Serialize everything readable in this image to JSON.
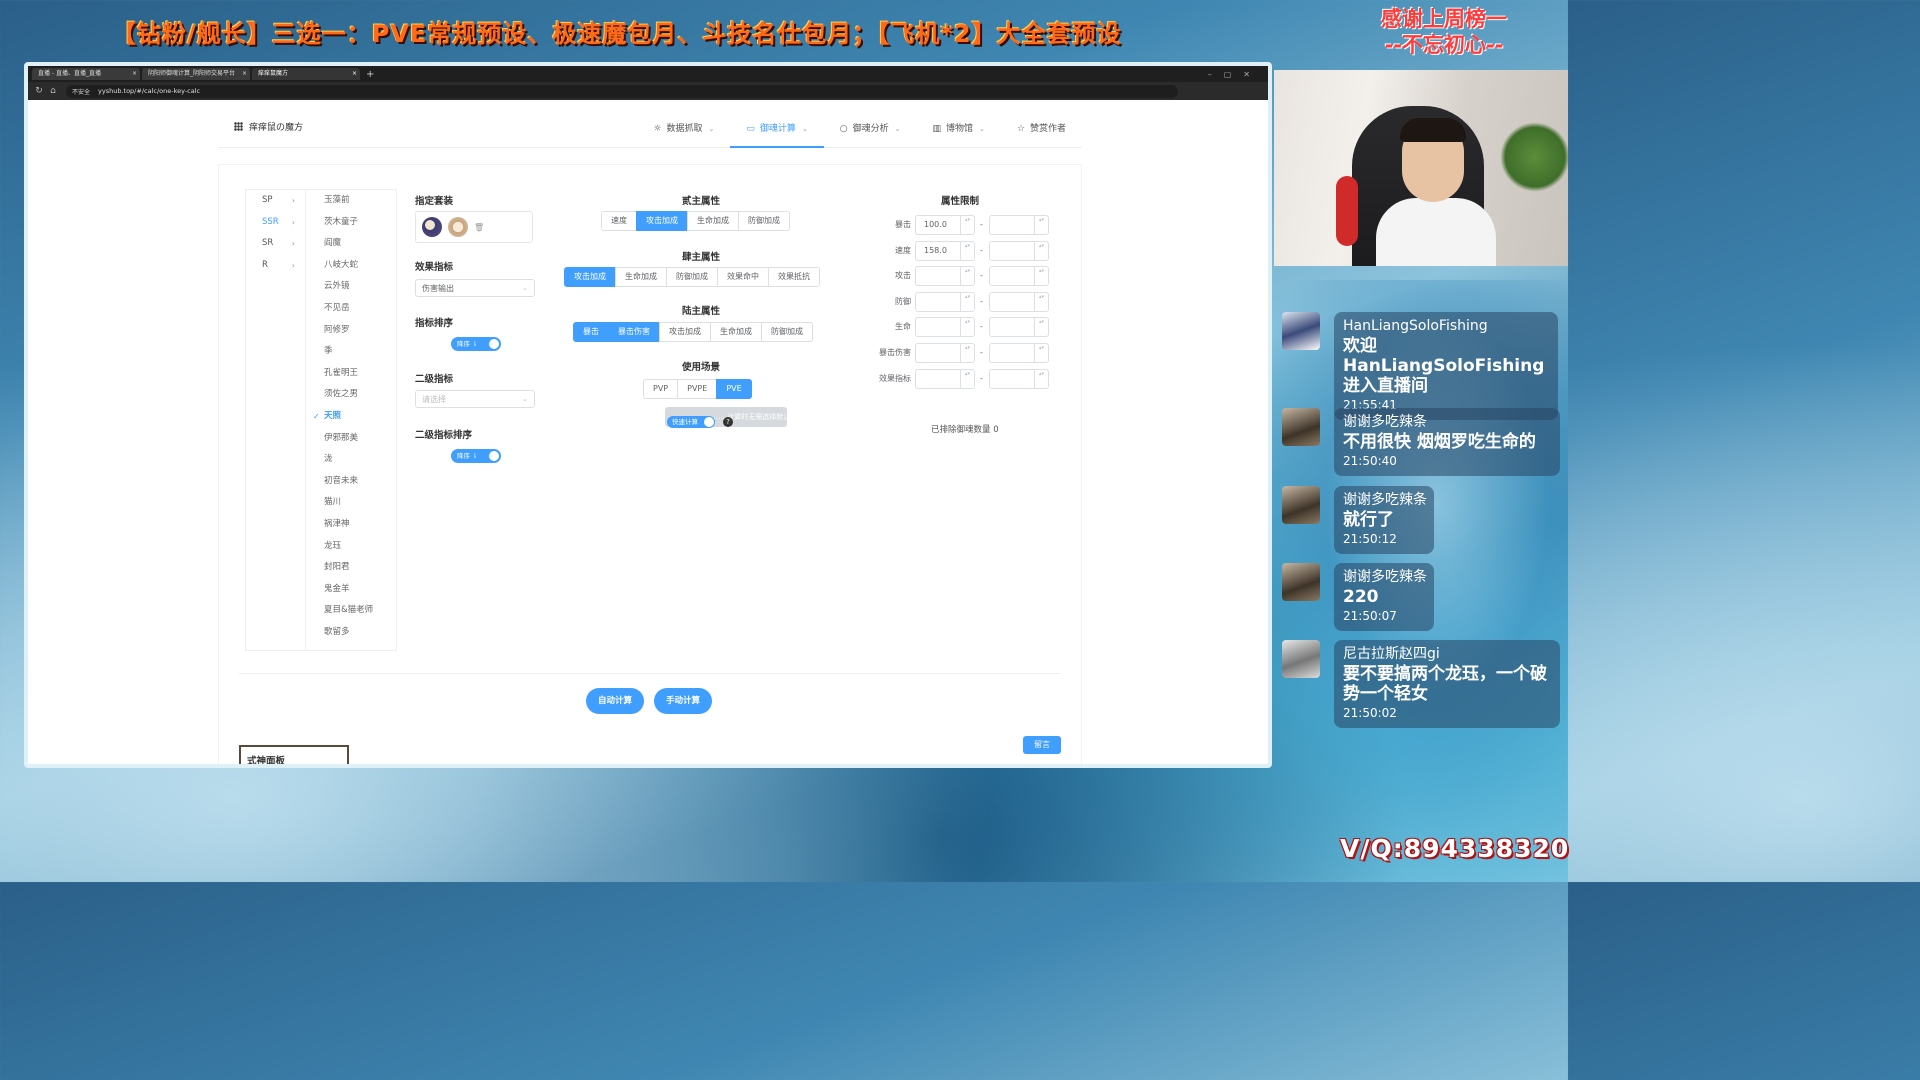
{
  "stream": {
    "title": "【钻粉/舰长】三选一：PVE常规预设、极速魔包月、斗技名仕包月；【飞机*2】大全套预设",
    "thanks_line1": "感谢上周榜一",
    "thanks_line2": "--不忘初心--",
    "contact": "V/Q:894338320"
  },
  "browser": {
    "tabs": [
      {
        "label": "直播 - 直播、直播_直播",
        "close": "×"
      },
      {
        "label": "阴阳师御魂计算_阴阳师交易平台",
        "close": "×"
      },
      {
        "label": "痒痒鼠魔方",
        "close": "×"
      }
    ],
    "new_tab": "+",
    "insecure_label": "不安全",
    "url": "yyshub.top/#/calc/one-key-calc"
  },
  "site": {
    "brand": "痒痒鼠の魔方",
    "menu": [
      {
        "icon": "☼",
        "label": "数据抓取",
        "chev": "⌄"
      },
      {
        "icon": "▭",
        "label": "御魂计算",
        "chev": "⌄",
        "active": true
      },
      {
        "icon": "○",
        "label": "御魂分析",
        "chev": "⌄"
      },
      {
        "icon": "▥",
        "label": "博物馆",
        "chev": "⌄"
      },
      {
        "icon": "☆",
        "label": "赞赏作者",
        "chev": ""
      }
    ]
  },
  "rarity": [
    {
      "label": "SP",
      "arrow": "›"
    },
    {
      "label": "SSR",
      "arrow": "›",
      "active": true
    },
    {
      "label": "SR",
      "arrow": "›"
    },
    {
      "label": "R",
      "arrow": "›"
    }
  ],
  "shikigami": [
    "玉藻前",
    "茨木童子",
    "阎魔",
    "八岐大蛇",
    "云外镜",
    "不见岳",
    "阿修罗",
    "季",
    "孔雀明王",
    "须佐之男",
    "天照",
    "伊邪那美",
    "泷",
    "初音未来",
    "猫川",
    "祸津神",
    "龙珏",
    "封阳君",
    "鬼金羊",
    "夏目&猫老师",
    "歌留多"
  ],
  "shikigami_active_index": 10,
  "form": {
    "suit_label": "指定套装",
    "effect_label": "效果指标",
    "effect_value": "伤害输出",
    "sort_label": "指标排序",
    "sort_switch": "降序 ⇂",
    "second_label": "二级指标",
    "second_placeholder": "请选择",
    "second_sort_label": "二级指标排序",
    "second_sort_switch": "降序 ⇂",
    "select_chev": "⌄",
    "trash": "🗑"
  },
  "attrs": {
    "two_label": "贰主属性",
    "two": [
      "速度",
      "攻击加成",
      "生命加成",
      "防御加成"
    ],
    "two_active": 1,
    "four_label": "肆主属性",
    "four": [
      "攻击加成",
      "生命加成",
      "防御加成",
      "效果命中",
      "效果抵抗"
    ],
    "four_active": 0,
    "six_label": "陆主属性",
    "six": [
      "暴击",
      "暴击伤害",
      "攻击加成",
      "生命加成",
      "防御加成"
    ],
    "six_active": [
      0,
      1
    ],
    "scene_label": "使用场景",
    "scene": [
      "PVP",
      "PVPE",
      "PVE"
    ],
    "scene_active": 2,
    "quick_switch": "快速计算",
    "quick_tip": "…… 计算时无需选择默认加成",
    "help": "?"
  },
  "limits": {
    "title": "属性限制",
    "dash": "-",
    "spin": "▴▾",
    "rows": [
      {
        "label": "暴击",
        "min": "100.0",
        "max": ""
      },
      {
        "label": "速度",
        "min": "158.0",
        "max": ""
      },
      {
        "label": "攻击",
        "min": "",
        "max": ""
      },
      {
        "label": "防御",
        "min": "",
        "max": ""
      },
      {
        "label": "生命",
        "min": "",
        "max": ""
      },
      {
        "label": "暴击伤害",
        "min": "",
        "max": ""
      },
      {
        "label": "效果指标",
        "min": "",
        "max": ""
      }
    ],
    "excluded": "已排除御魂数量 0"
  },
  "actions": {
    "auto": "自动计算",
    "manual": "手动计算",
    "message": "留言",
    "panel_tab": "式神面板"
  },
  "chat": [
    {
      "name": "HanLiangSoloFishing",
      "text": "欢迎 HanLiangSoloFishing 进入直播间",
      "time": "21:55:41"
    },
    {
      "name": "谢谢多吃辣条",
      "text": "不用很快 烟烟罗吃生命的",
      "time": "21:50:40"
    },
    {
      "name": "谢谢多吃辣条",
      "text": "就行了",
      "time": "21:50:12"
    },
    {
      "name": "谢谢多吃辣条",
      "text": "220",
      "time": "21:50:07"
    },
    {
      "name": "尼古拉斯赵四gi",
      "text": "要不要搞两个龙珏，一个破势一个轻女",
      "time": "21:50:02"
    }
  ]
}
